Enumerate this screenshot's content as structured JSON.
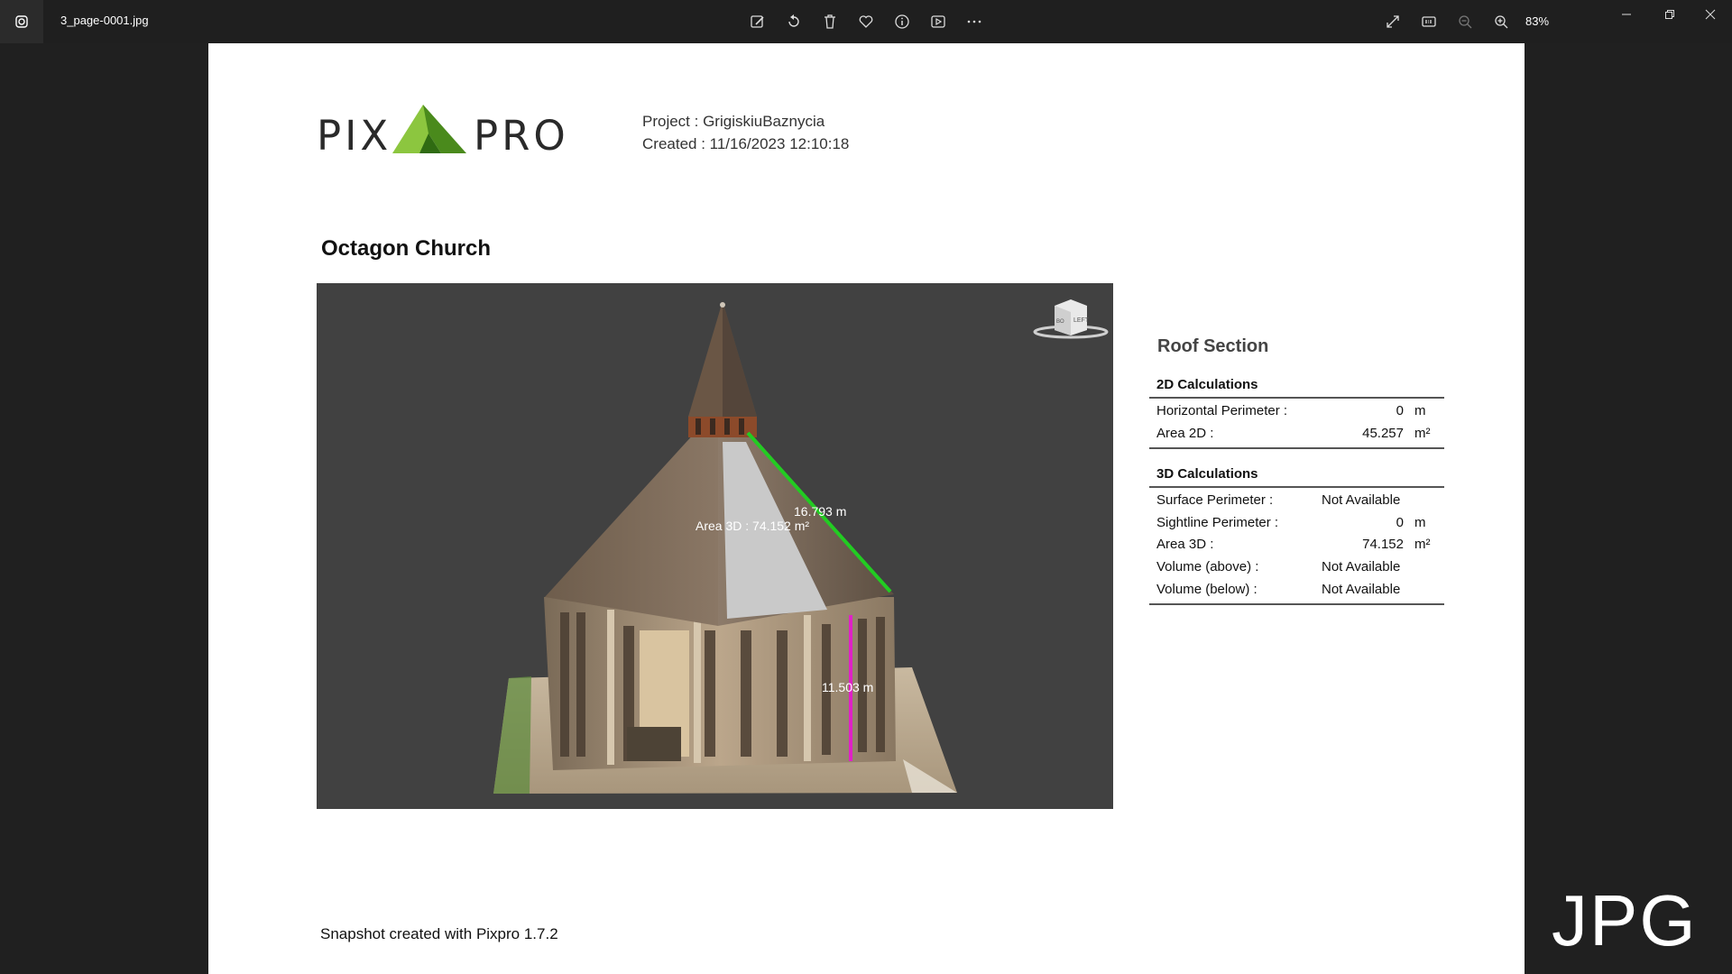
{
  "window": {
    "file_name": "3_page-0001.jpg",
    "zoom": "83%",
    "toolbar_icons": [
      "edit-image-icon",
      "rotate-icon",
      "delete-icon",
      "favorite-icon",
      "info-icon",
      "slideshow-icon",
      "more-icon"
    ],
    "right_icons": [
      "full-screen-icon",
      "actual-size-icon",
      "zoom-out-icon",
      "zoom-in-icon"
    ],
    "format_badge": "JPG"
  },
  "document": {
    "logo_left": "PIX",
    "logo_right": "PRO",
    "project_line": "Project : GrigiskiuBaznycia",
    "created_line": "Created : 11/16/2023 12:10:18",
    "title": "Octagon Church",
    "footer": "Snapshot created with Pixpro 1.7.2",
    "viewport": {
      "edge_label": "16.793 m",
      "area_label": "Area 3D : 74.152 m²",
      "height_label": "11.503 m",
      "cube_face_left": "LEFT",
      "cube_face_bottom": "BO"
    }
  },
  "panel": {
    "title": "Roof Section",
    "section_2d": {
      "title": "2D Calculations",
      "rows": [
        {
          "label": "Horizontal Perimeter :",
          "value": "0",
          "unit": "m"
        },
        {
          "label": "Area 2D :",
          "value": "45.257",
          "unit": "m²"
        }
      ]
    },
    "section_3d": {
      "title": "3D Calculations",
      "rows": [
        {
          "label": "Surface Perimeter :",
          "value": "Not Available",
          "unit": ""
        },
        {
          "label": "Sightline Perimeter :",
          "value": "0",
          "unit": "m"
        },
        {
          "label": "Area 3D :",
          "value": "74.152",
          "unit": "m²"
        },
        {
          "label": "Volume (above) :",
          "value": "Not Available",
          "unit": ""
        },
        {
          "label": "Volume (below) :",
          "value": "Not Available",
          "unit": ""
        }
      ]
    }
  },
  "colors": {
    "logo_green": "#6aa229",
    "measure_green": "#22cc22",
    "measure_magenta": "#e020c8",
    "viewport_bg": "#414141"
  }
}
